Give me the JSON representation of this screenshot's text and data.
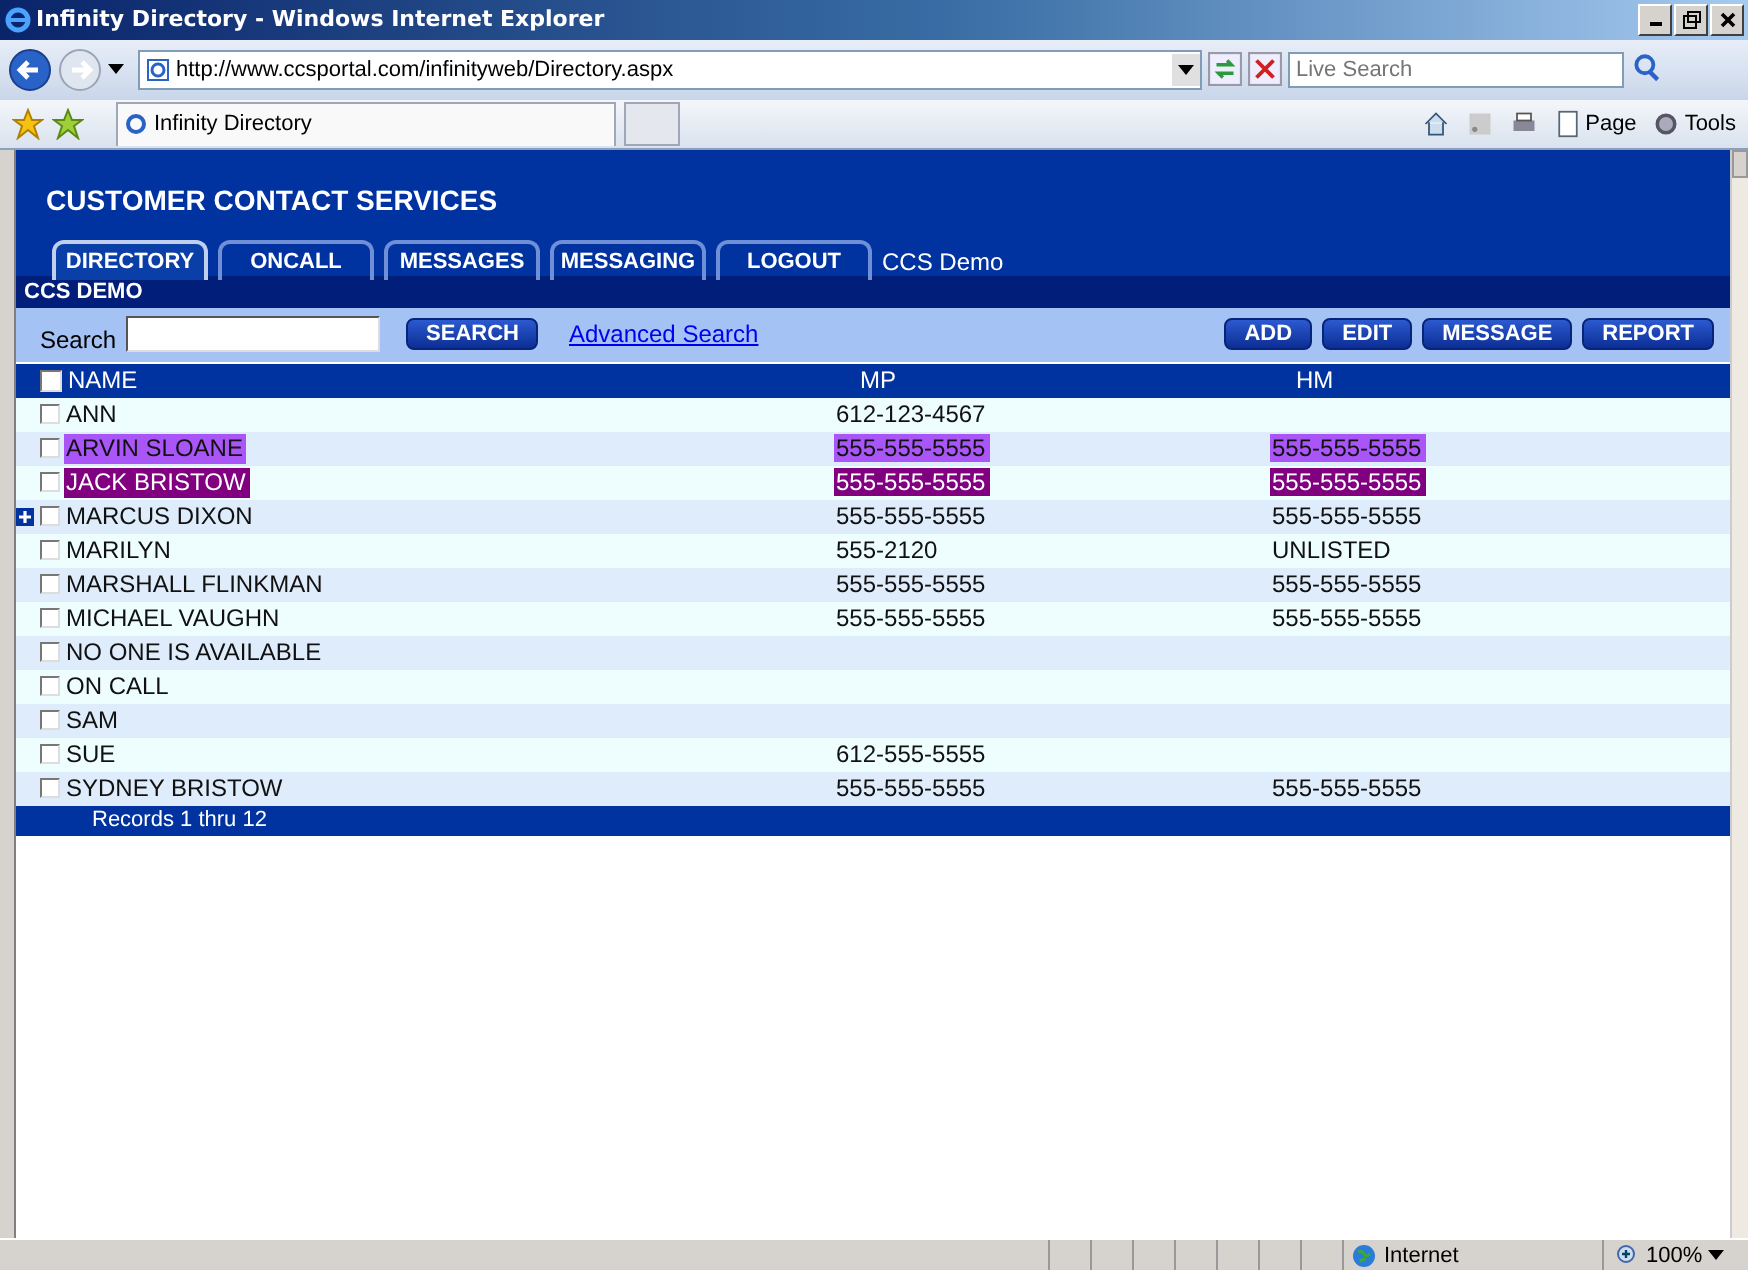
{
  "window": {
    "title": "Infinity Directory - Windows Internet Explorer"
  },
  "address_bar": {
    "url": "http://www.ccsportal.com/infinityweb/Directory.aspx"
  },
  "search_box": {
    "placeholder": "Live Search"
  },
  "browser_tab": {
    "title": "Infinity Directory"
  },
  "command_bar": [
    "Page",
    "Tools"
  ],
  "page": {
    "title": "CUSTOMER CONTACT SERVICES",
    "tabs": [
      {
        "label": "DIRECTORY",
        "selected": true
      },
      {
        "label": "ONCALL",
        "selected": false
      },
      {
        "label": "MESSAGES",
        "selected": false
      },
      {
        "label": "MESSAGING",
        "selected": false
      },
      {
        "label": "LOGOUT",
        "selected": false
      }
    ],
    "user_label": "CCS Demo",
    "account_bar": "CCS DEMO",
    "search": {
      "label": "Search",
      "button": "SEARCH",
      "link": "Advanced Search"
    },
    "actions": [
      "ADD",
      "EDIT",
      "MESSAGE",
      "REPORT"
    ],
    "table": {
      "select_all_checked": false,
      "columns": [
        "NAME",
        "MP",
        "HM"
      ],
      "rows": [
        {
          "checked": false,
          "expandable": false,
          "name": "ANN",
          "mp": "612-123-4567"
        },
        {
          "checked": false,
          "expandable": false,
          "color": "#aa55f8",
          "name": "ARVIN SLOANE",
          "mp": "555-555-5555",
          "hm": "555-555-5555"
        },
        {
          "checked": false,
          "expandable": false,
          "color": "#800080",
          "name": "JACK BRISTOW",
          "mp": "555-555-5555",
          "hm": "555-555-5555"
        },
        {
          "checked": false,
          "expandable": true,
          "name": "MARCUS DIXON",
          "mp": "555-555-5555",
          "hm": "555-555-5555"
        },
        {
          "checked": false,
          "expandable": false,
          "name": "MARILYN",
          "mp": "555-2120",
          "hm": "UNLISTED"
        },
        {
          "checked": false,
          "expandable": false,
          "name": "MARSHALL FLINKMAN",
          "mp": "555-555-5555",
          "hm": "555-555-5555"
        },
        {
          "checked": false,
          "expandable": false,
          "name": "MICHAEL VAUGHN",
          "mp": "555-555-5555",
          "hm": "555-555-5555"
        },
        {
          "checked": false,
          "expandable": false,
          "name": "NO ONE IS AVAILABLE"
        },
        {
          "checked": false,
          "expandable": false,
          "name": "ON CALL"
        },
        {
          "checked": false,
          "expandable": false,
          "name": "SAM"
        },
        {
          "checked": false,
          "expandable": false,
          "name": "SUE",
          "mp": "612-555-5555"
        },
        {
          "checked": false,
          "expandable": false,
          "name": "SYDNEY BRISTOW",
          "mp": "555-555-5555",
          "hm": "555-555-5555"
        }
      ],
      "footer": "Records 1 thru  12"
    }
  },
  "status_bar": {
    "zone": "Internet",
    "zoom": "100%"
  }
}
